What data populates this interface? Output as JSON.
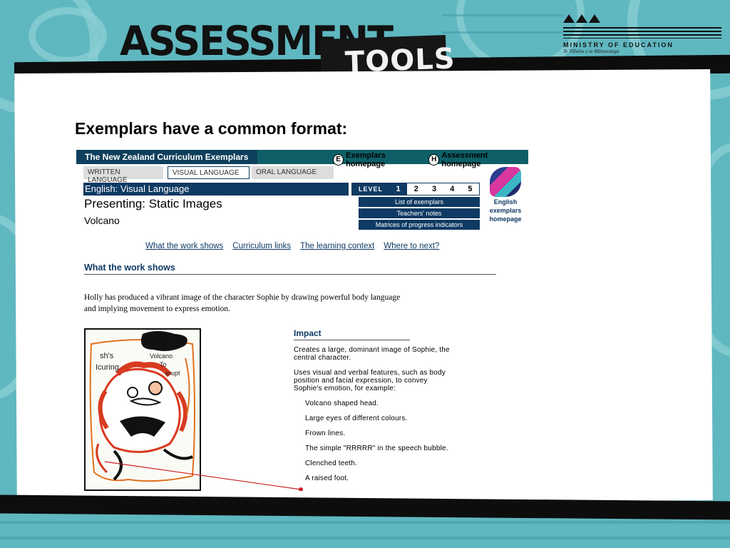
{
  "header": {
    "logo_word_1": "ASSESSMENT",
    "logo_word_2": "TOOLS",
    "ministry_name": "MINISTRY OF EDUCATION",
    "ministry_subtitle": "Te Tāhuhu o te Mātauranga"
  },
  "slide_title": "Exemplars have a common format:",
  "webpage": {
    "site_title": "The New Zealand Curriculum Exemplars",
    "nav": [
      {
        "icon_letter": "E",
        "label": "Exemplars homepage"
      },
      {
        "icon_letter": "H",
        "label": "Assessment homepage"
      }
    ],
    "tabs": [
      "WRITTEN LANGUAGE",
      "VISUAL LANGUAGE",
      "ORAL LANGUAGE"
    ],
    "active_tab": "VISUAL LANGUAGE",
    "subject": "English: Visual Language",
    "level_label": "LEVEL",
    "levels": [
      "1",
      "2",
      "3",
      "4",
      "5"
    ],
    "current_level": "1",
    "side_buttons": [
      "List of exemplars",
      "Teachers' notes",
      "Matrices of progress indicators"
    ],
    "english_logo_lines": [
      "English",
      "exemplars",
      "homepage"
    ],
    "presenting": "Presenting: Static Images",
    "topic": "Volcano",
    "anchor_links": [
      "What the work shows",
      "Curriculum links",
      "The learning context",
      "Where to next?"
    ],
    "section_heading": "What the work shows",
    "intro_text": "Holly has produced a vibrant image of the character Sophie by drawing powerful body language and implying movement to express emotion.",
    "artwork_texts": [
      "sh's",
      "Icuring",
      "Volcano",
      "To",
      "erupt"
    ],
    "impact": {
      "heading": "Impact",
      "points": [
        "Creates a large, dominant image of Sophie, the central character.",
        "Uses visual and verbal features, such as body position and facial expression, to convey Sophie's emotion, for example:"
      ],
      "examples": [
        "Volcano shaped head.",
        "Large eyes of different colours.",
        "Frown lines.",
        "The simple \"RRRRR\" in the speech bubble.",
        "Clenched teeth.",
        "A raised foot."
      ]
    }
  },
  "colors": {
    "background_teal": "#5fb7c0",
    "header_black": "#0d0d0d",
    "web_navy": "#0e3a63",
    "web_teal": "#0e5f67",
    "pointer_red": "#cc1f1f"
  }
}
